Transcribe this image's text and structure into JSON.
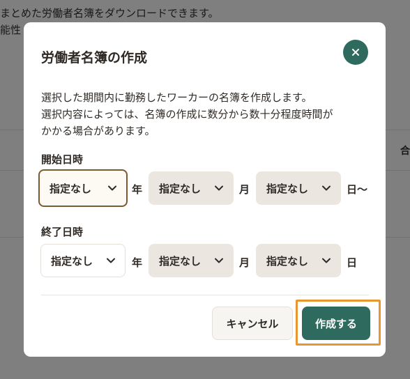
{
  "background": {
    "line1": "まとめた労働者名簿をダウンロードできます。",
    "line2": "能性",
    "edge_text": "合"
  },
  "modal": {
    "title": "労働者名簿の作成",
    "description": [
      "選択した期間内に勤務したワーカーの名簿を作成します。",
      "選択内容によっては、名簿の作成に数分から数十分程度時間が",
      "かかる場合があります。"
    ],
    "start": {
      "label": "開始日時",
      "year": "指定なし",
      "month": "指定なし",
      "day": "指定なし",
      "unit_year": "年",
      "unit_month": "月",
      "unit_day": "日〜"
    },
    "end": {
      "label": "終了日時",
      "year": "指定なし",
      "month": "指定なし",
      "day": "指定なし",
      "unit_year": "年",
      "unit_month": "月",
      "unit_day": "日"
    },
    "cancel_label": "キャンセル",
    "create_label": "作成する"
  },
  "colors": {
    "primary": "#2e6b5e",
    "highlight": "#e8962f",
    "focus_border": "#7a5a30",
    "select_bg": "#ebe7e0"
  },
  "icons": {
    "close": "close-icon",
    "dropdown": "chevron-down-icon"
  }
}
